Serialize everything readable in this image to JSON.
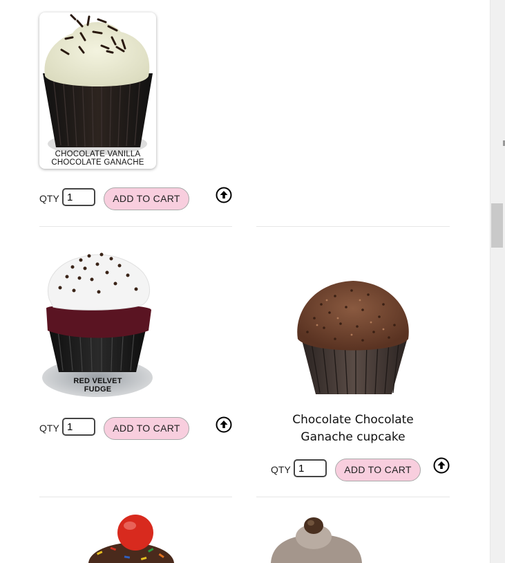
{
  "qty_label": "QTY",
  "add_to_cart_label": "ADD TO CART",
  "products": [
    {
      "image_caption_line1": "CHOCOLATE VANILLA",
      "image_caption_line2": "CHOCOLATE GANACHE",
      "qty": "1"
    },
    {
      "image_caption_line1": "RED VELVET",
      "image_caption_line2": "FUDGE",
      "qty": "1"
    },
    {
      "title_line1": "Chocolate Chocolate",
      "title_line2": "Ganache cupcake",
      "qty": "1"
    }
  ],
  "colors": {
    "button_bg": "#f8cede",
    "divider": "#e6e6e6"
  },
  "icons": {
    "scroll_up": "circle-arrow-up-icon"
  }
}
